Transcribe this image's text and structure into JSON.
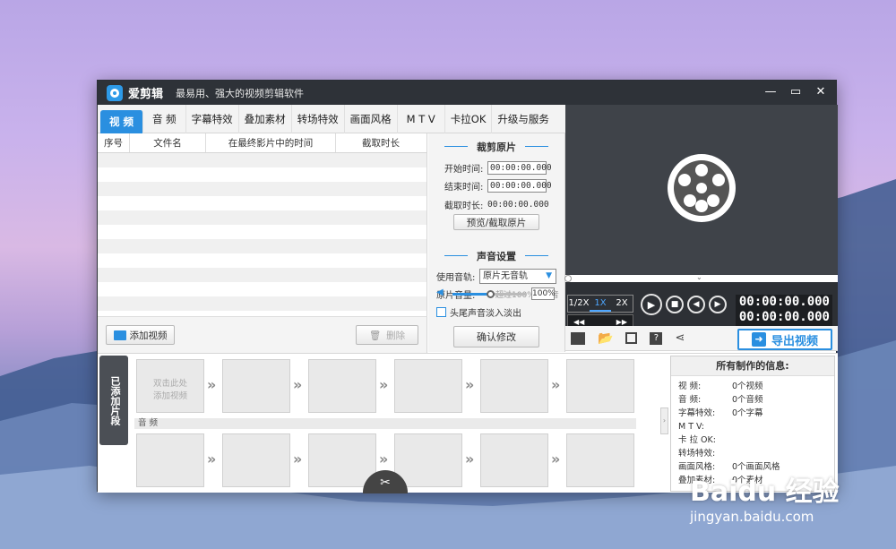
{
  "app": {
    "title": "爱剪辑",
    "slogan": "最易用、强大的视频剪辑软件"
  },
  "window_controls": {
    "minimize": "—",
    "maximize": "▭",
    "close": "✕"
  },
  "tabs": [
    {
      "label": "视 频",
      "active": true
    },
    {
      "label": "音 频"
    },
    {
      "label": "字幕特效"
    },
    {
      "label": "叠加素材"
    },
    {
      "label": "转场特效"
    },
    {
      "label": "画面风格"
    },
    {
      "label": "M T V"
    },
    {
      "label": "卡拉OK"
    },
    {
      "label": "升级与服务"
    }
  ],
  "file_table": {
    "columns": [
      "序号",
      "文件名",
      "在最终影片中的时间",
      "截取时长"
    ]
  },
  "file_actions": {
    "add_video": "添加视频",
    "delete": "删除"
  },
  "crop": {
    "title": "裁剪原片",
    "start_label": "开始时间:",
    "start_value": "00:00:00.000",
    "end_label": "结束时间:",
    "end_value": "00:00:00.000",
    "duration_label": "截取时长:",
    "duration_value": "00:00:00.000",
    "preview_button": "预览/截取原片"
  },
  "audio": {
    "title": "声音设置",
    "track_label": "使用音轨:",
    "track_value": "原片无音轨",
    "volume_label": "原片音量:",
    "volume_hint": "超过100%为扩音",
    "volume_value": "100%",
    "fade_label": "头尾声音淡入淡出",
    "fade_checked": false,
    "confirm_button": "确认修改"
  },
  "player": {
    "speeds": [
      "1/2X",
      "1X",
      "2X"
    ],
    "active_speed": "1X",
    "time_current": "00:00:00.000",
    "time_total": "00:00:00.000",
    "export_button": "导出视频"
  },
  "timeline": {
    "side_tab": "已添加片段",
    "first_clip_text": "双击此处\n添加视频",
    "audio_label": "音 频"
  },
  "info": {
    "title": "所有制作的信息:",
    "rows": [
      {
        "k": "视    频:",
        "v": "0个视频"
      },
      {
        "k": "音    频:",
        "v": "0个音频"
      },
      {
        "k": "字幕特效:",
        "v": "0个字幕"
      },
      {
        "k": "M  T  V:",
        "v": ""
      },
      {
        "k": "卡 拉 OK:",
        "v": ""
      },
      {
        "k": "转场特效:",
        "v": ""
      },
      {
        "k": "画面风格:",
        "v": "0个画面风格"
      },
      {
        "k": "叠加素材:",
        "v": "0个素材"
      }
    ]
  },
  "watermark": {
    "text": "Baidu 经验",
    "url": "jingyan.baidu.com"
  },
  "colors": {
    "accent": "#2a8fe0",
    "titlebar": "#2e3238",
    "player_bg": "#3b3f45"
  }
}
